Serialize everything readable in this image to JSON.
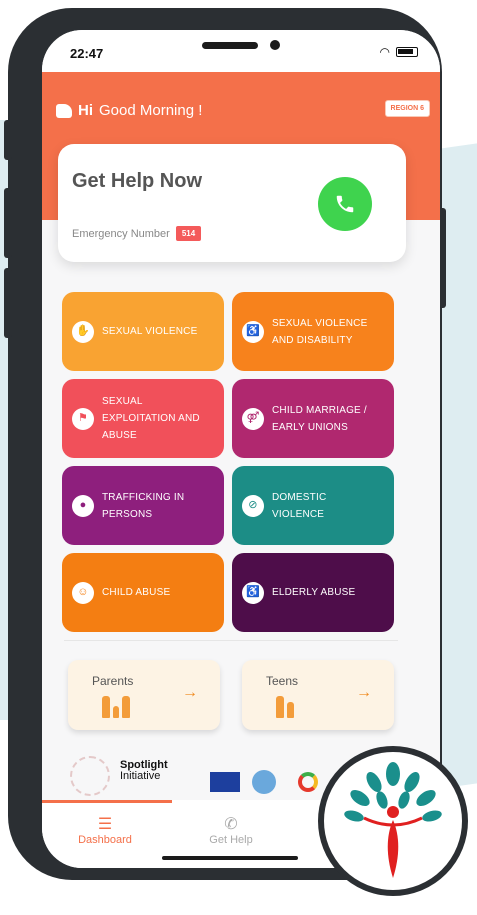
{
  "status_bar": {
    "time": "22:47",
    "wifi": "wifi-icon",
    "battery": "battery-icon"
  },
  "header": {
    "greeting_prefix": "Hi",
    "greeting_text": "Good Morning !",
    "region_badge": "REGION 6",
    "color": "#f4704a"
  },
  "help_card": {
    "title": "Get Help Now",
    "emergency_label": "Emergency Number",
    "emergency_number": "514",
    "call_icon": "phone-icon"
  },
  "categories": [
    {
      "label": "SEXUAL VIOLENCE",
      "color": "#f9a332",
      "icon": "shield-icon",
      "glyph": "✋"
    },
    {
      "label": "SEXUAL VIOLENCE\nAND DISABILITY",
      "color": "#f7821c",
      "icon": "disability-icon",
      "glyph": "♿"
    },
    {
      "label": "SEXUAL\nEXPLOITATION AND\nABUSE",
      "color": "#f1505a",
      "icon": "flag-icon",
      "glyph": "⚑"
    },
    {
      "label": "CHILD MARRIAGE /\nEARLY UNIONS",
      "color": "#b0286f",
      "icon": "couple-icon",
      "glyph": "⚤"
    },
    {
      "label": "TRAFFICKING IN\nPERSONS",
      "color": "#8e1f7d",
      "icon": "person-icon",
      "glyph": "●"
    },
    {
      "label": "DOMESTIC\nVIOLENCE",
      "color": "#1c8d86",
      "icon": "no-violence-icon",
      "glyph": "⊘"
    },
    {
      "label": "CHILD ABUSE",
      "color": "#f47e12",
      "icon": "child-icon",
      "glyph": "☺"
    },
    {
      "label": "ELDERLY ABUSE",
      "color": "#4e0d4a",
      "icon": "elderly-icon",
      "glyph": "♿"
    }
  ],
  "audience": [
    {
      "label": "Parents",
      "arrow": "→",
      "icon": "parents-icon"
    },
    {
      "label": "Teens",
      "arrow": "→",
      "icon": "teens-icon"
    }
  ],
  "partners": {
    "spotlight_title": "Spotlight",
    "spotlight_sub": "Initiative"
  },
  "nav": [
    {
      "label": "Dashboard",
      "icon": "dashboard-icon",
      "glyph": "☰",
      "active": true,
      "color": "#f4704a"
    },
    {
      "label": "Get Help",
      "icon": "phone-icon",
      "glyph": "✆",
      "active": false,
      "color": "#aaaaaa"
    }
  ]
}
